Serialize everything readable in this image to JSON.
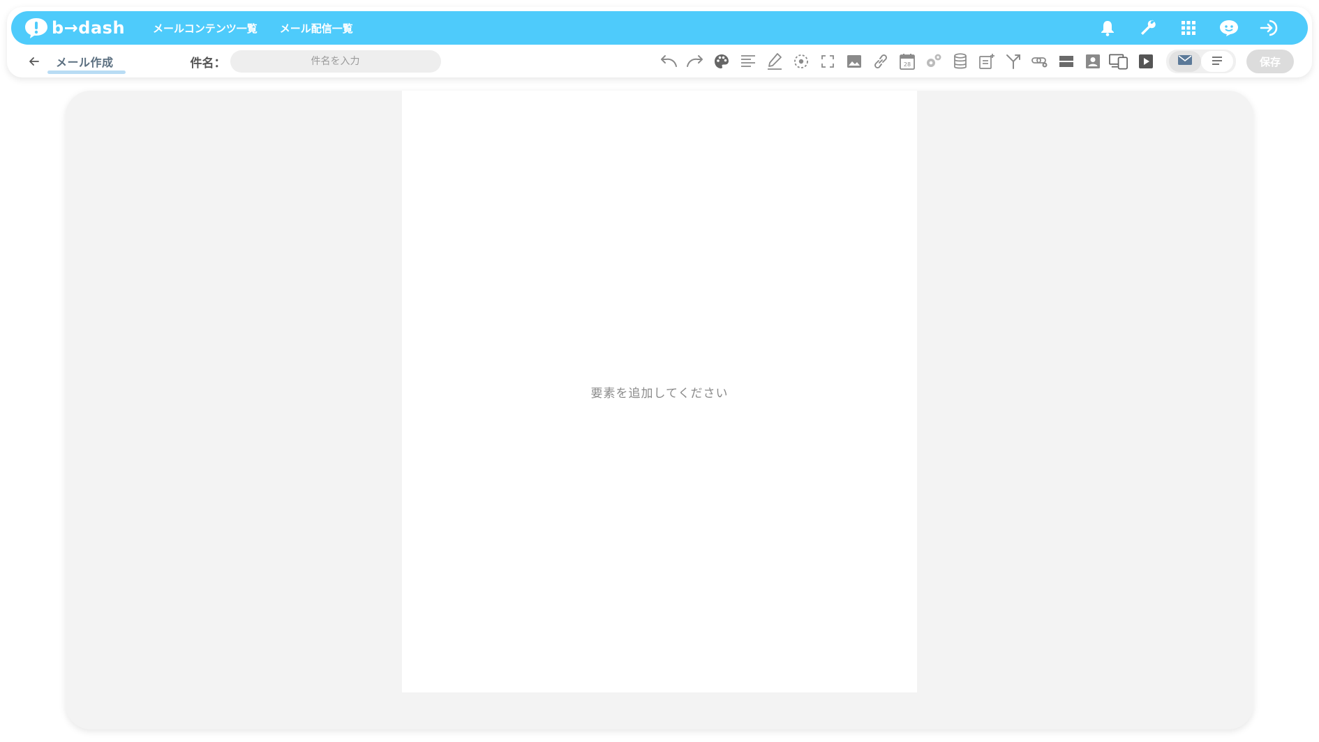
{
  "header": {
    "logo_text": "b→dash",
    "nav": [
      {
        "label": "メールコンテンツ一覧"
      },
      {
        "label": "メール配信一覧"
      }
    ],
    "icons": [
      "bell-icon",
      "wrench-icon",
      "apps-grid-icon",
      "chat-bot-icon",
      "logout-icon"
    ]
  },
  "toolbar": {
    "page_title": "メール作成",
    "subject_label": "件名：",
    "subject_value": "",
    "subject_placeholder": "件名を入力",
    "tools": [
      "undo-icon",
      "redo-icon",
      "palette-icon",
      "align-icon",
      "highlight-pen-icon",
      "target-icon",
      "fullscreen-icon",
      "image-icon",
      "link-icon",
      "calendar-icon",
      "settings-gears-icon",
      "database-icon",
      "note-add-icon",
      "merge-icon",
      "link-settings-icon",
      "block-icon",
      "contact-card-icon",
      "devices-icon",
      "video-play-icon"
    ],
    "view_mail_icon": "mail-icon",
    "view_text_icon": "text-lines-icon",
    "save_label": "保存"
  },
  "canvas": {
    "empty_message": "要素を追加してください"
  },
  "colors": {
    "header_bg": "#4ecbfb",
    "canvas_bg": "#f3f3f3",
    "icon_gray": "#8a8a8a"
  }
}
